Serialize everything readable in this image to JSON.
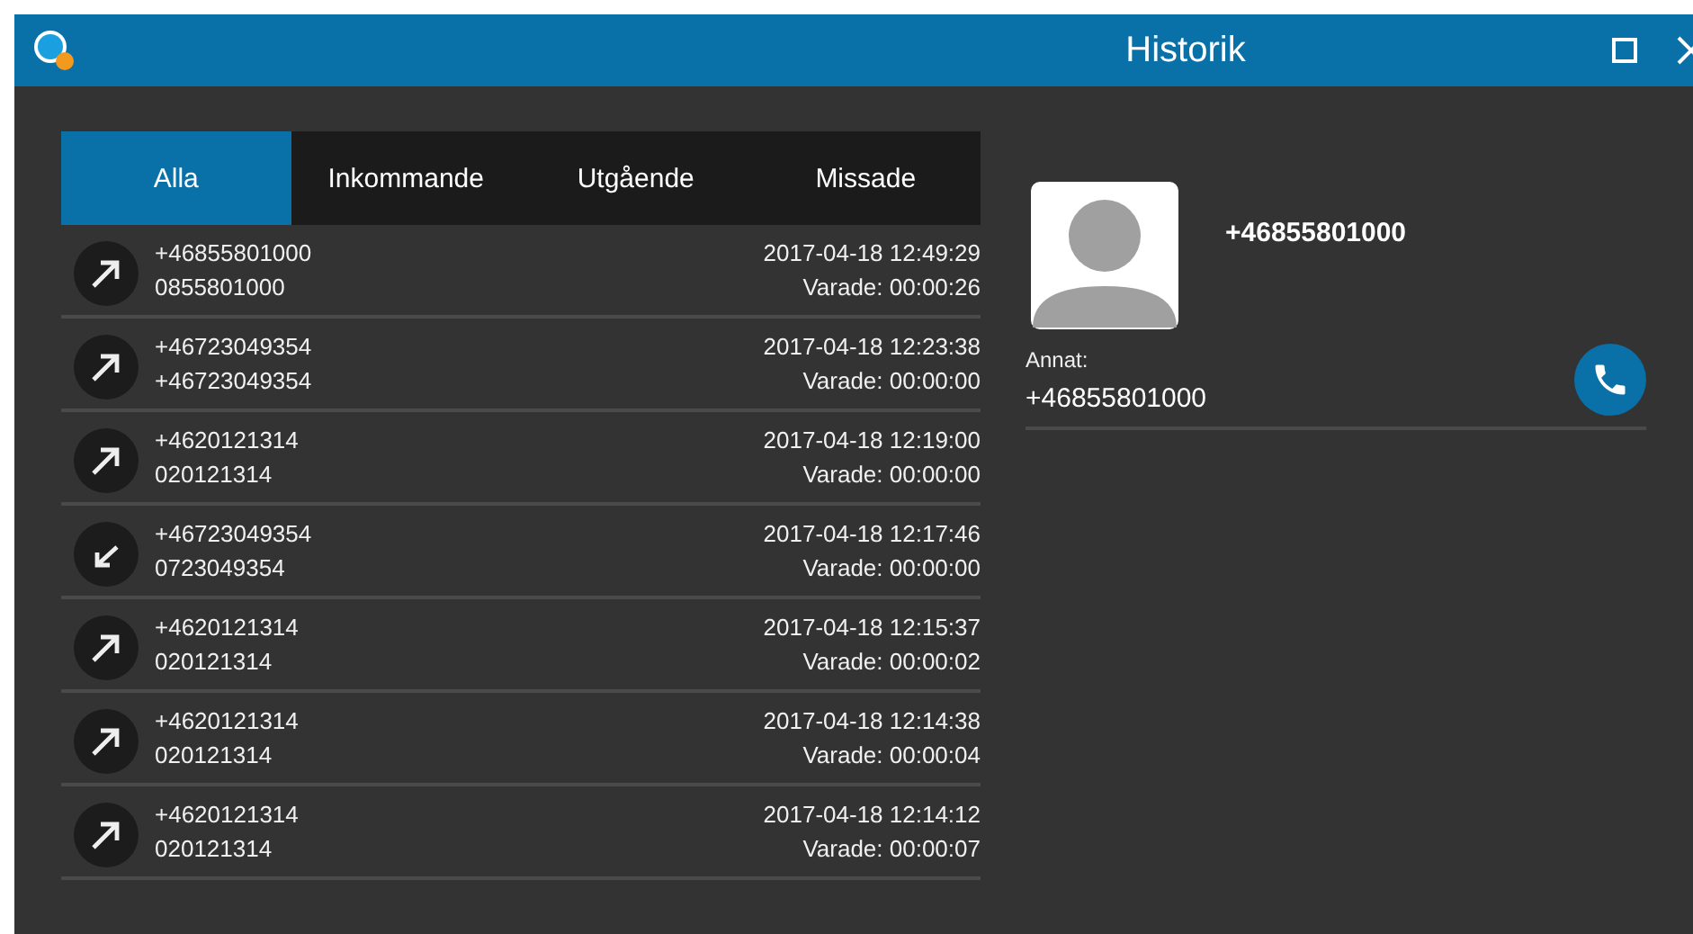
{
  "window": {
    "title": "Historik"
  },
  "tabs": [
    {
      "label": "Alla",
      "selected": true
    },
    {
      "label": "Inkommande",
      "selected": false
    },
    {
      "label": "Utgående",
      "selected": false
    },
    {
      "label": "Missade",
      "selected": false
    }
  ],
  "calls": [
    {
      "kind": "outgoing",
      "number": "+46855801000",
      "subtitle": "0855801000",
      "time": "2017-04-18 12:49:29",
      "duration": "Varade: 00:00:26"
    },
    {
      "kind": "outgoing",
      "number": "+46723049354",
      "subtitle": "+46723049354",
      "time": "2017-04-18 12:23:38",
      "duration": "Varade: 00:00:00"
    },
    {
      "kind": "outgoing",
      "number": "+4620121314",
      "subtitle": "020121314",
      "time": "2017-04-18 12:19:00",
      "duration": "Varade: 00:00:00"
    },
    {
      "kind": "incoming",
      "number": "+46723049354",
      "subtitle": "0723049354",
      "time": "2017-04-18 12:17:46",
      "duration": "Varade: 00:00:00"
    },
    {
      "kind": "outgoing",
      "number": "+4620121314",
      "subtitle": "020121314",
      "time": "2017-04-18 12:15:37",
      "duration": "Varade: 00:00:02"
    },
    {
      "kind": "outgoing",
      "number": "+4620121314",
      "subtitle": "020121314",
      "time": "2017-04-18 12:14:38",
      "duration": "Varade: 00:00:04"
    },
    {
      "kind": "outgoing",
      "number": "+4620121314",
      "subtitle": "020121314",
      "time": "2017-04-18 12:14:12",
      "duration": "Varade: 00:00:07"
    }
  ],
  "detail": {
    "name": "+46855801000",
    "label": "Annat:",
    "number": "+46855801000"
  }
}
